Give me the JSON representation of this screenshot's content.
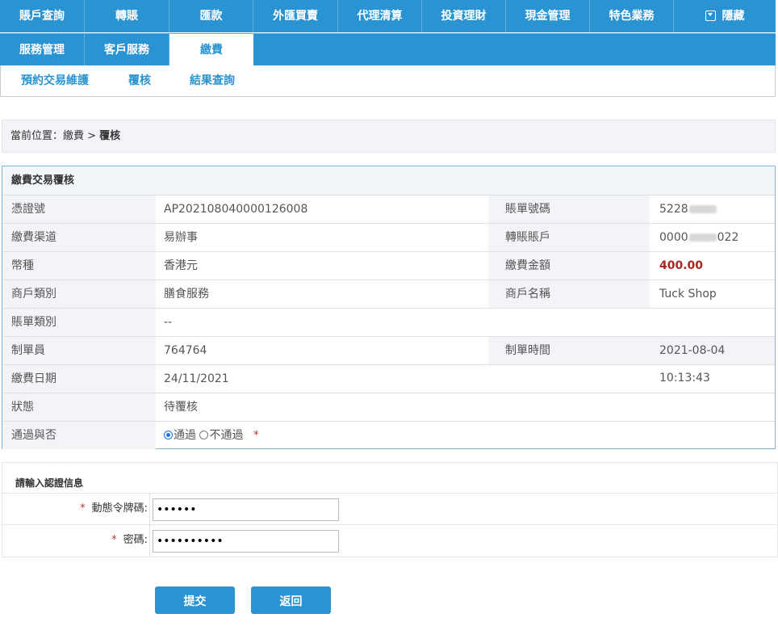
{
  "nav": {
    "row1": [
      "賬戶查詢",
      "轉賬",
      "匯款",
      "外匯買賣",
      "代理清算",
      "投資理財",
      "現金管理",
      "特色業務"
    ],
    "hide_label": "隱藏",
    "row2": [
      "服務管理",
      "客戶服務",
      "繳費"
    ]
  },
  "subnav": [
    "預約交易維護",
    "覆核",
    "結果查詢"
  ],
  "breadcrumb": {
    "prefix": "當前位置：繳費 > ",
    "current": "覆核"
  },
  "panel": {
    "title": "繳費交易覆核",
    "fields": {
      "voucher_label": "憑證號",
      "voucher_value": "AP202108040000126008",
      "bill_no_label": "賬單號碼",
      "bill_no_value": "5228",
      "channel_label": "繳費渠道",
      "channel_value": "易辦事",
      "account_label": "轉賬賬戶",
      "account_prefix": "0000",
      "account_suffix": "022",
      "currency_label": "幣種",
      "currency_value": "香港元",
      "amount_label": "繳費金額",
      "amount_value": "400.00",
      "merchant_type_label": "商戶類別",
      "merchant_type_value": "膳食服務",
      "merchant_name_label": "商戶名稱",
      "merchant_name_value": "Tuck Shop",
      "bill_type_label": "賬單類別",
      "bill_type_value": "--",
      "maker_label": "制單員",
      "maker_value": "764764",
      "make_time_label": "制單時間",
      "make_time_value": "2021-08-04 10:13:43",
      "pay_date_label": "繳費日期",
      "pay_date_value": "24/11/2021",
      "status_label": "狀態",
      "status_value": "待覆核",
      "approve_label": "通過與否",
      "approve_yes": "通過",
      "approve_no": "不通過",
      "required_mark": "*"
    }
  },
  "auth": {
    "title": "請輸入認證信息",
    "token_label": "動態令牌碼:",
    "token_value": "••••••",
    "password_label": "密碼:",
    "password_value": "••••••••••",
    "required_mark": "*"
  },
  "buttons": {
    "submit": "提交",
    "back": "返回"
  }
}
